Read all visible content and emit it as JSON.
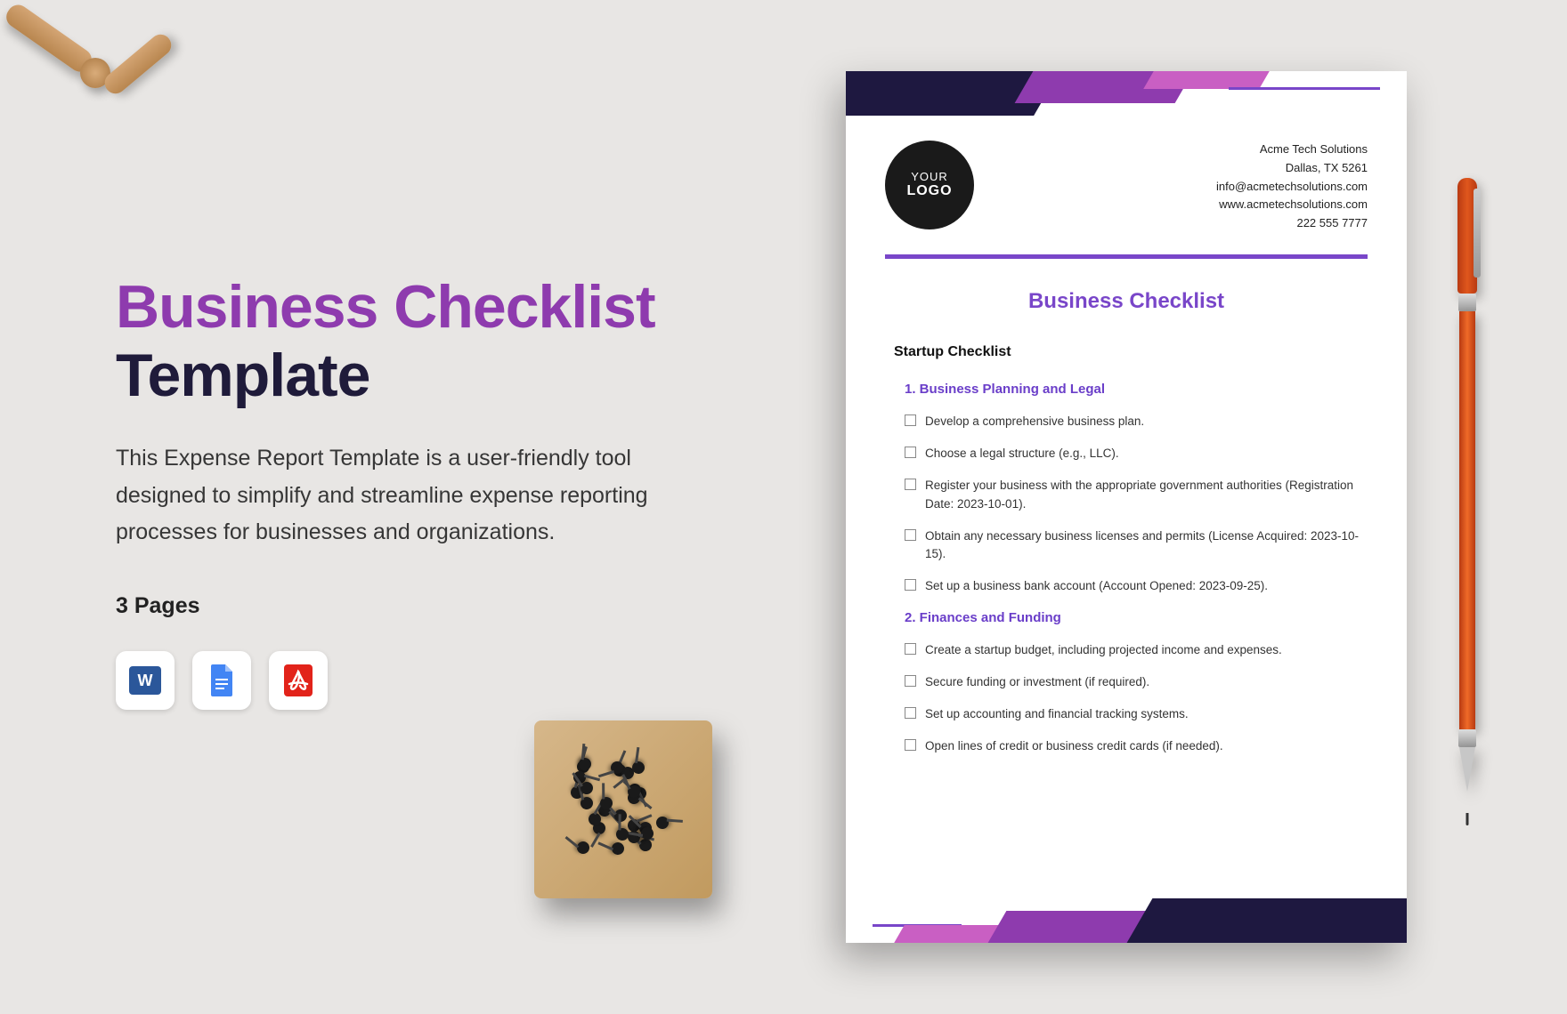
{
  "title_line1": "Business Checklist",
  "title_line2": "Template",
  "description": "This Expense Report Template is a user-friendly tool designed to simplify and streamline expense reporting processes for businesses and organizations.",
  "pages_label": "3 Pages",
  "formats": [
    "word",
    "google-docs",
    "pdf"
  ],
  "document": {
    "logo_line1": "YOUR",
    "logo_line2": "LOGO",
    "company": {
      "name": "Acme Tech Solutions",
      "city": "Dallas, TX 5261",
      "email": "info@acmetechsolutions.com",
      "website": "www.acmetechsolutions.com",
      "phone": "222 555 7777"
    },
    "heading": "Business Checklist",
    "subheading": "Startup Checklist",
    "sections": [
      {
        "num": "1.",
        "title": "Business Planning and Legal",
        "items": [
          "Develop a comprehensive business plan.",
          "Choose a legal structure (e.g., LLC).",
          "Register your business with the appropriate government authorities (Registration Date: 2023-10-01).",
          "Obtain any necessary business licenses and permits (License Acquired: 2023-10-15).",
          "Set up a business bank account (Account Opened: 2023-09-25)."
        ]
      },
      {
        "num": "2.",
        "title": "Finances and Funding",
        "items": [
          "Create a startup budget, including projected income and expenses.",
          "Secure funding or investment (if required).",
          "Set up accounting and financial tracking systems.",
          "Open lines of credit or business credit cards (if needed)."
        ]
      }
    ]
  }
}
